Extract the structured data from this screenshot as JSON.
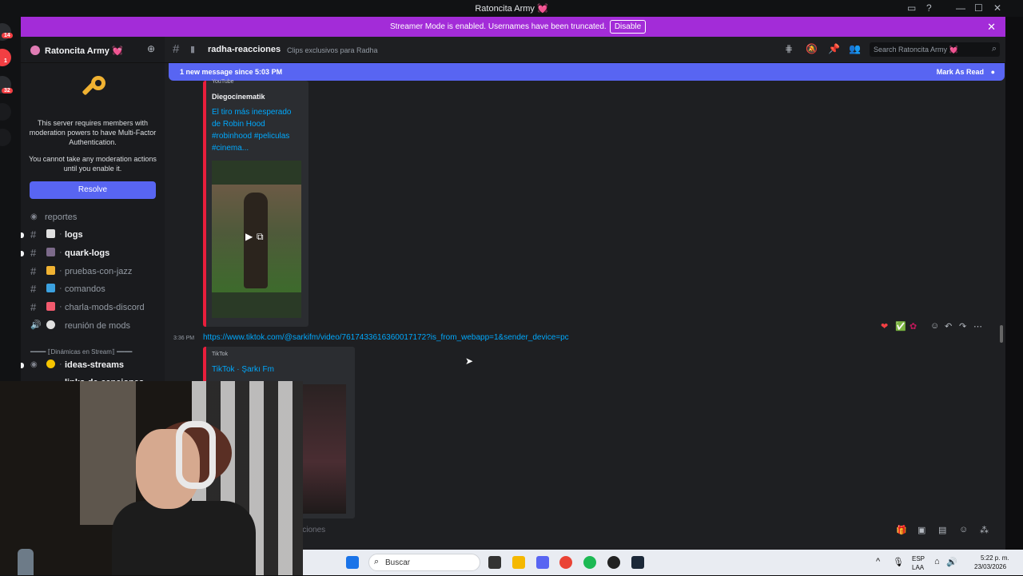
{
  "window": {
    "title": "Ratoncita Army 💓",
    "controls": [
      "—",
      "☐",
      "✕"
    ]
  },
  "guild_rail": {
    "badges": [
      "14",
      "1",
      "32"
    ]
  },
  "streamer_banner": {
    "message": "Streamer Mode is enabled. Usernames have been truncated.",
    "button": "Disable",
    "close": "✕"
  },
  "sidebar": {
    "server_name": "Ratoncita Army 💓",
    "chevron": "⌄",
    "mfa": {
      "line1": "This server requires members with moderation powers to have Multi-Factor Authentication.",
      "line2": "You cannot take any moderation actions until you enable it.",
      "button": "Resolve"
    },
    "channels": [
      {
        "label": "reportes",
        "emoji": "",
        "bold": false,
        "dot": false,
        "hash": "⬤"
      },
      {
        "label": "logs",
        "emoji": "#e0e0e0",
        "bold": true,
        "dot": true,
        "hash": "#"
      },
      {
        "label": "quark-logs",
        "emoji": "#7c6a8a",
        "bold": true,
        "dot": true,
        "hash": "#"
      },
      {
        "label": "pruebas-con-jazz",
        "emoji": "#f0b232",
        "bold": false,
        "dot": false,
        "hash": "#"
      },
      {
        "label": "comandos",
        "emoji": "#3ba1e0",
        "bold": false,
        "dot": false,
        "hash": "#"
      },
      {
        "label": "charla-mods-discord",
        "emoji": "#f25a6e",
        "bold": false,
        "dot": false,
        "hash": "#"
      },
      {
        "label": "reunión de mods",
        "emoji": "#e0e0e0",
        "bold": false,
        "dot": false,
        "hash": "🔊"
      }
    ],
    "category": "━━━━ ⟦Dinámicas en Stream⟧ ━━━━",
    "channels2": [
      {
        "label": "ideas-streams",
        "emoji": "#f5c400",
        "bold": true,
        "dot": true
      },
      {
        "label": "links-de-canciones",
        "emoji": "#6b5bd6",
        "bold": true,
        "dot": true
      }
    ]
  },
  "channel_header": {
    "name": "radha-reacciones",
    "topic": "Clips exclusivos para Radha",
    "search_placeholder": "Search Ratoncita Army 💓"
  },
  "chat": {
    "new_messages": "1 new message since 5:03 PM",
    "mark_as_read": "Mark As Read",
    "embed1": {
      "provider": "YouTube",
      "author": "Diegocinematik",
      "title": "El tiro más inesperado de Robin Hood #robinhood #peliculas #cinema..."
    },
    "message": {
      "time": "3:36 PM",
      "link": "https://www.tiktok.com/@sarkifm/video/7617433616360017172?is_from_webapp=1&sender_device=pc"
    },
    "embed2": {
      "provider": "TikTok",
      "title": "TikTok · Şarkı Fm"
    },
    "composer_placeholder": "iciones"
  },
  "taskbar": {
    "search": "Buscar",
    "lang1": "ESP",
    "lang2": "LAA",
    "time": "5:22 p. m.",
    "date": "23/03/2026"
  }
}
